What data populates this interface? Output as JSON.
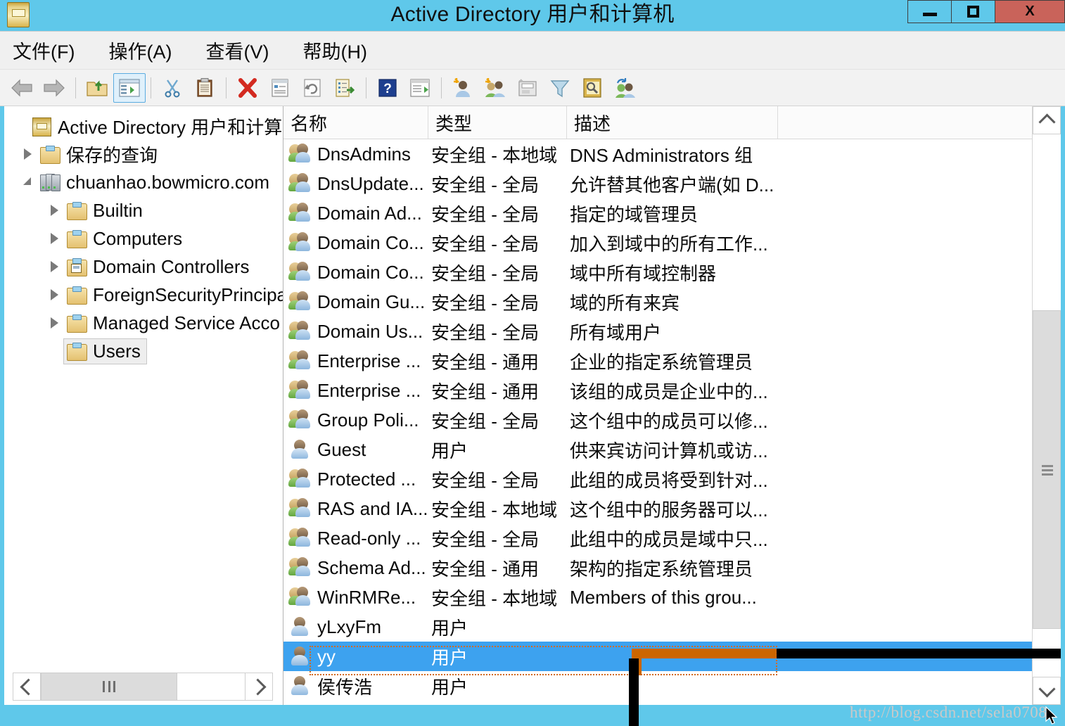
{
  "window": {
    "title": "Active Directory 用户和计算机",
    "app_icon": "console-root-icon",
    "controls": {
      "minimize": "–",
      "maximize": "□",
      "close": "X"
    },
    "titlebar_color": "#5fc8ea",
    "close_color": "#c9635a"
  },
  "menubar": {
    "items": [
      {
        "label": "文件(F)",
        "name": "menu-file"
      },
      {
        "label": "操作(A)",
        "name": "menu-action"
      },
      {
        "label": "查看(V)",
        "name": "menu-view"
      },
      {
        "label": "帮助(H)",
        "name": "menu-help"
      }
    ]
  },
  "toolbar": {
    "buttons": [
      {
        "name": "back-button",
        "icon": "back-arrow-icon",
        "selected": false
      },
      {
        "name": "forward-button",
        "icon": "forward-arrow-icon",
        "selected": false
      },
      {
        "name": "up-one-level-button",
        "icon": "up-folder-icon",
        "selected": false
      },
      {
        "name": "show-hide-console-tree-button",
        "icon": "console-tree-icon",
        "selected": true
      },
      {
        "name": "cut-button",
        "icon": "scissors-icon",
        "selected": false
      },
      {
        "name": "paste-button",
        "icon": "clipboard-icon",
        "selected": false
      },
      {
        "name": "delete-button",
        "icon": "red-x-icon",
        "selected": false
      },
      {
        "name": "properties-button",
        "icon": "properties-icon",
        "selected": false
      },
      {
        "name": "refresh-button",
        "icon": "refresh-icon",
        "selected": false
      },
      {
        "name": "export-list-button",
        "icon": "export-list-icon",
        "selected": false
      },
      {
        "name": "help-button",
        "icon": "question-mark-icon",
        "selected": false
      },
      {
        "name": "show-hide-action-pane-button",
        "icon": "action-pane-icon",
        "selected": false
      },
      {
        "name": "new-user-button",
        "icon": "new-user-icon",
        "selected": false
      },
      {
        "name": "new-group-button",
        "icon": "new-group-icon",
        "selected": false
      },
      {
        "name": "new-container-button",
        "icon": "new-container-icon",
        "selected": false
      },
      {
        "name": "filter-button",
        "icon": "funnel-icon",
        "selected": false
      },
      {
        "name": "find-button",
        "icon": "find-magnifier-icon",
        "selected": false
      },
      {
        "name": "delegate-control-button",
        "icon": "delegate-users-icon",
        "selected": false
      }
    ]
  },
  "tree": {
    "nodes": [
      {
        "label": "Active Directory 用户和计算机",
        "icon": "console-root-icon",
        "indent": 0,
        "expander": "none",
        "selected": false,
        "name": "tree-node-console-root"
      },
      {
        "label": "保存的查询",
        "icon": "folder-icon",
        "indent": 1,
        "expander": "collapsed",
        "selected": false,
        "name": "tree-node-saved-queries"
      },
      {
        "label": "chuanhao.bowmicro.com",
        "icon": "domain-icon",
        "indent": 1,
        "expander": "expanded",
        "selected": false,
        "name": "tree-node-domain"
      },
      {
        "label": "Builtin",
        "icon": "folder-icon",
        "indent": 2,
        "expander": "collapsed",
        "selected": false,
        "name": "tree-node-builtin"
      },
      {
        "label": "Computers",
        "icon": "folder-icon",
        "indent": 2,
        "expander": "collapsed",
        "selected": false,
        "name": "tree-node-computers"
      },
      {
        "label": "Domain Controllers",
        "icon": "domain-controllers-folder-icon",
        "indent": 2,
        "expander": "collapsed",
        "selected": false,
        "name": "tree-node-domain-controllers"
      },
      {
        "label": "ForeignSecurityPrincipa",
        "icon": "folder-icon",
        "indent": 2,
        "expander": "collapsed",
        "selected": false,
        "name": "tree-node-foreign-security-principals"
      },
      {
        "label": "Managed Service Acco",
        "icon": "folder-icon",
        "indent": 2,
        "expander": "collapsed",
        "selected": false,
        "name": "tree-node-managed-service-accounts"
      },
      {
        "label": "Users",
        "icon": "folder-icon",
        "indent": 2,
        "expander": "none",
        "selected": true,
        "name": "tree-node-users"
      }
    ]
  },
  "list": {
    "columns": [
      {
        "label": "名称",
        "name": "column-header-name"
      },
      {
        "label": "类型",
        "name": "column-header-type"
      },
      {
        "label": "描述",
        "name": "column-header-description"
      }
    ],
    "rows": [
      {
        "name": "DnsAdmins",
        "type": "安全组 - 本地域",
        "description": "DNS Administrators 组",
        "icon": "group-icon",
        "selected": false
      },
      {
        "name": "DnsUpdate...",
        "type": "安全组 - 全局",
        "description": "允许替其他客户端(如 D...",
        "icon": "group-icon",
        "selected": false
      },
      {
        "name": "Domain Ad...",
        "type": "安全组 - 全局",
        "description": "指定的域管理员",
        "icon": "group-icon",
        "selected": false
      },
      {
        "name": "Domain Co...",
        "type": "安全组 - 全局",
        "description": "加入到域中的所有工作...",
        "icon": "group-icon",
        "selected": false
      },
      {
        "name": "Domain Co...",
        "type": "安全组 - 全局",
        "description": "域中所有域控制器",
        "icon": "group-icon",
        "selected": false
      },
      {
        "name": "Domain Gu...",
        "type": "安全组 - 全局",
        "description": "域的所有来宾",
        "icon": "group-icon",
        "selected": false
      },
      {
        "name": "Domain Us...",
        "type": "安全组 - 全局",
        "description": "所有域用户",
        "icon": "group-icon",
        "selected": false
      },
      {
        "name": "Enterprise ...",
        "type": "安全组 - 通用",
        "description": "企业的指定系统管理员",
        "icon": "group-icon",
        "selected": false
      },
      {
        "name": "Enterprise ...",
        "type": "安全组 - 通用",
        "description": "该组的成员是企业中的...",
        "icon": "group-icon",
        "selected": false
      },
      {
        "name": "Group Poli...",
        "type": "安全组 - 全局",
        "description": "这个组中的成员可以修...",
        "icon": "group-icon",
        "selected": false
      },
      {
        "name": "Guest",
        "type": "用户",
        "description": "供来宾访问计算机或访...",
        "icon": "user-icon",
        "selected": false
      },
      {
        "name": "Protected ...",
        "type": "安全组 - 全局",
        "description": "此组的成员将受到针对...",
        "icon": "group-icon",
        "selected": false
      },
      {
        "name": "RAS and IA...",
        "type": "安全组 - 本地域",
        "description": "这个组中的服务器可以...",
        "icon": "group-icon",
        "selected": false
      },
      {
        "name": "Read-only ...",
        "type": "安全组 - 全局",
        "description": "此组中的成员是域中只...",
        "icon": "group-icon",
        "selected": false
      },
      {
        "name": "Schema Ad...",
        "type": "安全组 - 通用",
        "description": "架构的指定系统管理员",
        "icon": "group-icon",
        "selected": false
      },
      {
        "name": "WinRMRe...",
        "type": "安全组 - 本地域",
        "description": "Members of this grou...",
        "icon": "group-icon",
        "selected": false
      },
      {
        "name": "yLxyFm",
        "type": "用户",
        "description": "",
        "icon": "user-icon",
        "selected": false
      },
      {
        "name": "yy",
        "type": "用户",
        "description": "",
        "icon": "user-icon",
        "selected": true
      },
      {
        "name": "侯传浩",
        "type": "用户",
        "description": "",
        "icon": "user-icon",
        "selected": false
      }
    ]
  },
  "annotation": {
    "highlight_color": "#cc6600",
    "selection_color": "#3da2ef",
    "line_color": "#000000"
  },
  "watermark": {
    "text": "http://blog.csdn.net/sela0708"
  }
}
